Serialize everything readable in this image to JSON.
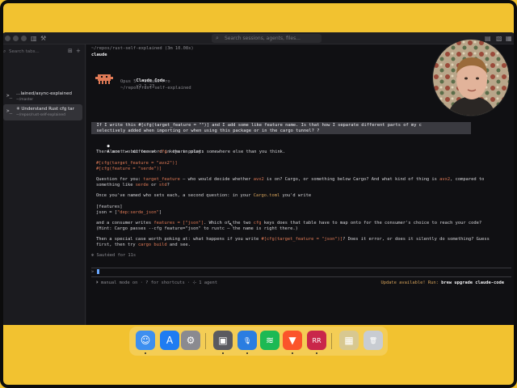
{
  "window": {
    "search_placeholder": "Search sessions, agents, files..."
  },
  "sidebar": {
    "search_placeholder": "Search tabs...",
    "items": [
      {
        "title": "…lained/async-explained",
        "subtitle": "~/master",
        "active": false
      },
      {
        "title": "✳ Understand Rust cfg tar",
        "subtitle": "~/repos/rust-self-explained",
        "active": true
      }
    ]
  },
  "terminal": {
    "path_line": "~/repos/rust-self-explained (3m 10.08s)",
    "header_word": "claude",
    "app_name": "Claude Code",
    "app_version": "v2.1.23",
    "model_line": "Opus 5 · Claude Pro",
    "cwd_line": "~/repos/rust-self-explained",
    "user_message_line1": "  If I write this #[cfg(target_feature = \"\")] and I add some like feature name. Is that how I separate different parts of my c",
    "user_message_line2": "  selectively added when importing or when using this package or in the cargo tunnel? ?",
    "bullet": "●",
    "lines": {
      "l1": "Almost — but one word in there points somewhere else than you think.",
      "l2a": "There are two different ",
      "l2b": "cfg",
      "l2c": " keys in play:",
      "l3": "#[cfg(target_feature = \"avx2\")]",
      "l4": "#[cfg(feature = \"serde\")]",
      "l5a": "Question for you: ",
      "l5b": "target_feature",
      "l5c": " — who would decide whether ",
      "l5d": "avx2",
      "l5e": " is on? Cargo, or something below Cargo? And what kind of thing is ",
      "l5f": "avx2",
      "l5g": ", compared to",
      "l6a": "something like ",
      "l6b": "serde",
      "l6c": " or ",
      "l6d": "std",
      "l6e": "?",
      "l7a": "Once you've named who sets each, a second question: in your ",
      "l7b": "Cargo.toml",
      "l7c": " you'd write",
      "l8": "[features]",
      "l9a": "json = [",
      "l9b": "\"dep:serde_json\"",
      "l9c": "]",
      "l10a": "and a consumer writes ",
      "l10b": "features = [\"json\"]",
      "l10c": ". Which of the two ",
      "l10d": "cfg",
      "l10e": " keys does that table have to map onto for the consumer's choice to reach your code?",
      "l11": "(Hint: Cargo passes --cfg feature=\"json\" to rustc — the name is right there.)",
      "l12a": "Then a special case worth poking at: what happens if you write ",
      "l12b": "#[cfg(target_feature = \"json\")]",
      "l12c": "? Does it error, or does it silently do something? Guess",
      "l13a": "first, then try ",
      "l13b": "cargo build",
      "l13c": " and see.",
      "l14": "✻ Sautéed for 11s"
    },
    "prompt_symbol": ">",
    "status_left": "⏵ manual mode on · ? for shortcuts · ⊹ 1 agent",
    "update_prefix": "Update available! Run: ",
    "update_command": "brew upgrade claude-code"
  },
  "colors": {
    "accent_orange": "#e07a56",
    "link_gold": "#d6a35a",
    "wallpaper": "#f2c230"
  },
  "dock": {
    "apps": [
      {
        "name": "finder-icon",
        "color": "#3d8ff0",
        "glyph": "☺"
      },
      {
        "name": "app-store-icon",
        "color": "#1f7cf2",
        "glyph": "A"
      },
      {
        "name": "system-settings-icon",
        "color": "#8a8a90",
        "glyph": "⚙"
      },
      {
        "name": "preview-icon",
        "color": "#5a5a60",
        "glyph": "▣"
      },
      {
        "name": "voice-memos-icon",
        "color": "#2a7de1",
        "glyph": "🎙"
      },
      {
        "name": "spotify-icon",
        "color": "#1db954",
        "glyph": "≋"
      },
      {
        "name": "brave-icon",
        "color": "#fb542b",
        "glyph": "▼"
      },
      {
        "name": "rustrover-icon",
        "color": "#c9274a",
        "glyph": "RR"
      },
      {
        "name": "downloads-stack-icon",
        "color": "#d8c890",
        "glyph": "▦"
      },
      {
        "name": "trash-icon",
        "color": "#c8ccd2",
        "glyph": "🗑"
      }
    ]
  }
}
